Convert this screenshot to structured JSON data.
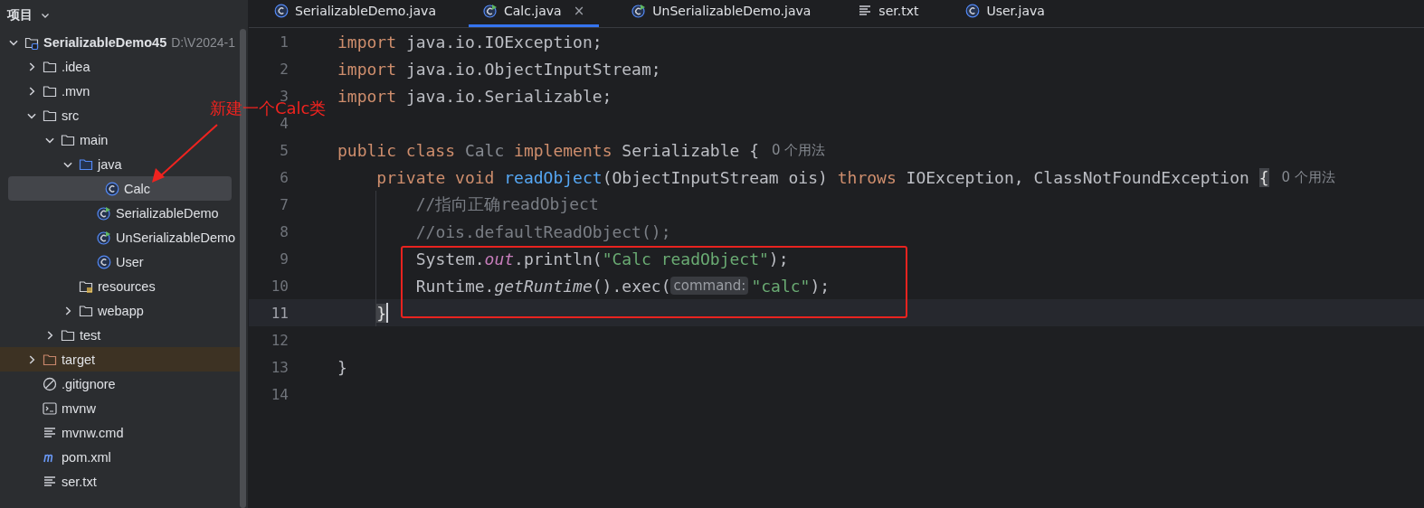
{
  "sidebar": {
    "title": "项目"
  },
  "tree": {
    "items": [
      {
        "label": "SerializableDemo45",
        "path": "D:\\V2024-1",
        "kind": "module",
        "expanded": true,
        "selected": false,
        "children": [
          {
            "label": ".idea",
            "kind": "folder",
            "expanded": false,
            "selected": false
          },
          {
            "label": ".mvn",
            "kind": "folder",
            "expanded": false,
            "selected": false
          },
          {
            "label": "src",
            "kind": "folder",
            "expanded": true,
            "selected": false,
            "children": [
              {
                "label": "main",
                "kind": "folder",
                "expanded": true,
                "selected": false,
                "children": [
                  {
                    "label": "java",
                    "kind": "source-folder",
                    "expanded": true,
                    "selected": false,
                    "children": [
                      {
                        "label": "Calc",
                        "kind": "class",
                        "selected": true
                      },
                      {
                        "label": "SerializableDemo",
                        "kind": "runnable-class",
                        "selected": false
                      },
                      {
                        "label": "UnSerializableDemo",
                        "kind": "runnable-class",
                        "selected": false
                      },
                      {
                        "label": "User",
                        "kind": "class",
                        "selected": false
                      }
                    ]
                  },
                  {
                    "label": "resources",
                    "kind": "resources-folder",
                    "selected": false
                  },
                  {
                    "label": "webapp",
                    "kind": "folder",
                    "expanded": false,
                    "selected": false
                  }
                ]
              },
              {
                "label": "test",
                "kind": "folder",
                "expanded": false,
                "selected": false
              }
            ]
          },
          {
            "label": "target",
            "kind": "excluded-folder",
            "expanded": false,
            "selected": false
          },
          {
            "label": ".gitignore",
            "kind": "ignore-file",
            "selected": false
          },
          {
            "label": "mvnw",
            "kind": "script-file",
            "selected": false
          },
          {
            "label": "mvnw.cmd",
            "kind": "text-file",
            "selected": false
          },
          {
            "label": "pom.xml",
            "kind": "maven-file",
            "selected": false
          },
          {
            "label": "ser.txt",
            "kind": "text-file",
            "selected": false
          }
        ]
      }
    ]
  },
  "tabs": [
    {
      "label": "SerializableDemo.java",
      "kind": "class",
      "selected": false,
      "closable": false
    },
    {
      "label": "Calc.java",
      "kind": "runnable-class",
      "selected": true,
      "closable": true,
      "close": "×"
    },
    {
      "label": "UnSerializableDemo.java",
      "kind": "runnable-class",
      "selected": false,
      "closable": false
    },
    {
      "label": "ser.txt",
      "kind": "text-file",
      "selected": false,
      "closable": false
    },
    {
      "label": "User.java",
      "kind": "class",
      "selected": false,
      "closable": false
    }
  ],
  "editor": {
    "lines": [
      {
        "number": "1",
        "current": false,
        "tokens": [
          {
            "kind": "keyword",
            "text": "import"
          },
          {
            "kind": "plain",
            "text": " java.io.IOException;"
          }
        ]
      },
      {
        "number": "2",
        "current": false,
        "tokens": [
          {
            "kind": "keyword",
            "text": "import"
          },
          {
            "kind": "plain",
            "text": " java.io.ObjectInputStream;"
          }
        ]
      },
      {
        "number": "3",
        "current": false,
        "tokens": [
          {
            "kind": "keyword",
            "text": "import"
          },
          {
            "kind": "plain",
            "text": " java.io.Serializable;"
          }
        ]
      },
      {
        "number": "4",
        "current": false
      },
      {
        "number": "5",
        "current": false,
        "tokens": [
          {
            "kind": "keyword",
            "text": "public class "
          },
          {
            "kind": "unused",
            "text": "Calc"
          },
          {
            "kind": "keyword",
            "text": " implements "
          },
          {
            "kind": "plain",
            "text": "Serializable {"
          },
          {
            "kind": "hint",
            "text": "0 个用法"
          }
        ]
      },
      {
        "number": "6",
        "current": false,
        "tokens": [
          {
            "kind": "keyword",
            "text": "    private void "
          },
          {
            "kind": "method",
            "text": "readObject"
          },
          {
            "kind": "plain",
            "text": "(ObjectInputStream ois) "
          },
          {
            "kind": "keyword",
            "text": "throws "
          },
          {
            "kind": "plain",
            "text": "IOException, ClassNotFoundException "
          },
          {
            "kind": "brace-match",
            "text": "{"
          },
          {
            "kind": "hint",
            "text": "0 个用法"
          }
        ]
      },
      {
        "number": "7",
        "current": false,
        "tokens": [
          {
            "kind": "comment",
            "text": "        //指向正确readObject"
          }
        ]
      },
      {
        "number": "8",
        "current": false,
        "tokens": [
          {
            "kind": "comment",
            "text": "        //ois.defaultReadObject();"
          }
        ]
      },
      {
        "number": "9",
        "current": false,
        "tokens": [
          {
            "kind": "plain",
            "text": "        System."
          },
          {
            "kind": "static-field",
            "text": "out"
          },
          {
            "kind": "plain",
            "text": ".println("
          },
          {
            "kind": "string",
            "text": "\"Calc readObject\""
          },
          {
            "kind": "plain",
            "text": ");"
          }
        ]
      },
      {
        "number": "10",
        "current": false,
        "tokens": [
          {
            "kind": "plain",
            "text": "        Runtime."
          },
          {
            "kind": "static-method",
            "text": "getRuntime"
          },
          {
            "kind": "plain",
            "text": "().exec("
          },
          {
            "kind": "inlay",
            "text": "command:"
          },
          {
            "kind": "string",
            "text": "\"calc\""
          },
          {
            "kind": "plain",
            "text": ");"
          }
        ]
      },
      {
        "number": "11",
        "current": true,
        "tokens": [
          {
            "kind": "brace-match",
            "text": "    }"
          }
        ]
      },
      {
        "number": "12",
        "current": false
      },
      {
        "number": "13",
        "current": false,
        "tokens": [
          {
            "kind": "plain",
            "text": "}"
          }
        ]
      },
      {
        "number": "14",
        "current": false
      }
    ]
  },
  "annotations": [
    {
      "kind": "note",
      "text": "新建一个Calc类"
    },
    {
      "kind": "arrow"
    },
    {
      "kind": "box"
    }
  ]
}
